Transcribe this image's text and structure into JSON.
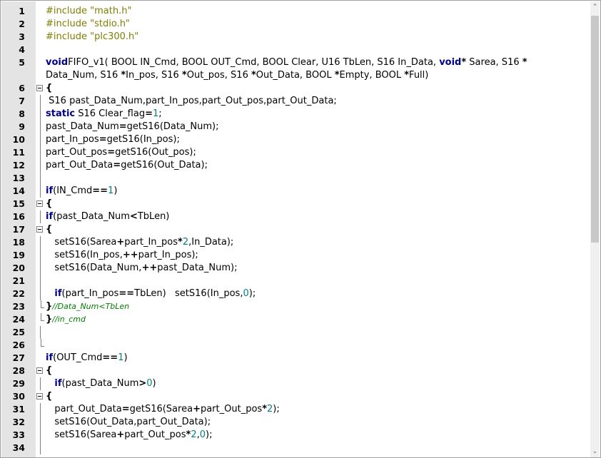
{
  "editor": {
    "lines": [
      {
        "n": "1",
        "fold": "",
        "tokens": [
          [
            "pp",
            "#include \"math.h\""
          ]
        ]
      },
      {
        "n": "2",
        "fold": "",
        "tokens": [
          [
            "pp",
            "#include \"stdio.h\""
          ]
        ]
      },
      {
        "n": "3",
        "fold": "",
        "tokens": [
          [
            "pp",
            "#include \"plc300.h\""
          ]
        ]
      },
      {
        "n": "4",
        "fold": "",
        "tokens": []
      },
      {
        "n": "5",
        "fold": "",
        "tall": true,
        "tokens": [
          [
            "kw",
            "void"
          ],
          [
            "",
            "FIFO_v1( BOOL IN_Cmd, BOOL OUT_Cmd, BOOL Clear, U16 TbLen, S16 In_Data, "
          ],
          [
            "kw",
            "void"
          ],
          [
            "op",
            "*"
          ],
          [
            "",
            " Sarea, S16 "
          ],
          [
            "op",
            "*"
          ],
          [
            "",
            "\nData_Num, S16 "
          ],
          [
            "op",
            "*"
          ],
          [
            "",
            "In_pos, S16 "
          ],
          [
            "op",
            "*"
          ],
          [
            "",
            "Out_pos, S16 "
          ],
          [
            "op",
            "*"
          ],
          [
            "",
            "Out_Data, BOOL "
          ],
          [
            "op",
            "*"
          ],
          [
            "",
            "Empty, BOOL "
          ],
          [
            "op",
            "*"
          ],
          [
            "",
            "Full)"
          ]
        ]
      },
      {
        "n": "6",
        "fold": "box",
        "tokens": [
          [
            "op",
            "{"
          ]
        ]
      },
      {
        "n": "7",
        "fold": "bar",
        "tokens": [
          [
            "",
            " S16 past_Data_Num,part_In_pos,part_Out_pos,part_Out_Data;"
          ]
        ]
      },
      {
        "n": "8",
        "fold": "bar",
        "tokens": [
          [
            "kw",
            "static"
          ],
          [
            "",
            " S16 Clear_flag"
          ],
          [
            "op",
            "="
          ],
          [
            "num",
            "1"
          ],
          [
            "",
            ";"
          ]
        ]
      },
      {
        "n": "9",
        "fold": "bar",
        "tokens": [
          [
            "",
            "past_Data_Num"
          ],
          [
            "op",
            "="
          ],
          [
            "",
            "getS16(Data_Num);"
          ]
        ]
      },
      {
        "n": "10",
        "fold": "bar",
        "tokens": [
          [
            "",
            "part_In_pos"
          ],
          [
            "op",
            "="
          ],
          [
            "",
            "getS16(In_pos);"
          ]
        ]
      },
      {
        "n": "11",
        "fold": "bar",
        "tokens": [
          [
            "",
            "part_Out_pos"
          ],
          [
            "op",
            "="
          ],
          [
            "",
            "getS16(Out_pos);"
          ]
        ]
      },
      {
        "n": "12",
        "fold": "bar",
        "tokens": [
          [
            "",
            "part_Out_Data"
          ],
          [
            "op",
            "="
          ],
          [
            "",
            "getS16(Out_Data);"
          ]
        ]
      },
      {
        "n": "13",
        "fold": "bar",
        "tokens": []
      },
      {
        "n": "14",
        "fold": "bar",
        "tokens": [
          [
            "kw",
            "if"
          ],
          [
            "",
            "(IN_Cmd"
          ],
          [
            "op",
            "=="
          ],
          [
            "num",
            "1"
          ],
          [
            "",
            ")"
          ]
        ]
      },
      {
        "n": "15",
        "fold": "box",
        "tokens": [
          [
            "op",
            "{"
          ]
        ]
      },
      {
        "n": "16",
        "fold": "bar",
        "tokens": [
          [
            "kw",
            "if"
          ],
          [
            "",
            "(past_Data_Num"
          ],
          [
            "op",
            "<"
          ],
          [
            "",
            "TbLen)"
          ]
        ]
      },
      {
        "n": "17",
        "fold": "box",
        "tokens": [
          [
            "op",
            "{"
          ]
        ]
      },
      {
        "n": "18",
        "fold": "bar",
        "tokens": [
          [
            "",
            "   setS16(Sarea"
          ],
          [
            "op",
            "+"
          ],
          [
            "",
            "part_In_pos"
          ],
          [
            "op",
            "*"
          ],
          [
            "num",
            "2"
          ],
          [
            "",
            ",In_Data);"
          ]
        ]
      },
      {
        "n": "19",
        "fold": "bar",
        "tokens": [
          [
            "",
            "   setS16(In_pos,"
          ],
          [
            "op",
            "++"
          ],
          [
            "",
            "part_In_pos);"
          ]
        ]
      },
      {
        "n": "20",
        "fold": "bar",
        "tokens": [
          [
            "",
            "   setS16(Data_Num,"
          ],
          [
            "op",
            "++"
          ],
          [
            "",
            "past_Data_Num);"
          ]
        ]
      },
      {
        "n": "21",
        "fold": "bar",
        "tokens": []
      },
      {
        "n": "22",
        "fold": "bar",
        "tokens": [
          [
            "",
            "   "
          ],
          [
            "kw",
            "if"
          ],
          [
            "",
            "(part_In_pos"
          ],
          [
            "op",
            "=="
          ],
          [
            "",
            "TbLen)   setS16(In_pos,"
          ],
          [
            "num",
            "0"
          ],
          [
            "",
            ");"
          ]
        ]
      },
      {
        "n": "23",
        "fold": "end",
        "tokens": [
          [
            "op",
            "}"
          ],
          [
            "cm",
            "//Data_Num<TbLen"
          ]
        ]
      },
      {
        "n": "24",
        "fold": "end",
        "tokens": [
          [
            "op",
            "}"
          ],
          [
            "cm",
            "//in_cmd"
          ]
        ]
      },
      {
        "n": "25",
        "fold": "bar",
        "tokens": []
      },
      {
        "n": "26",
        "fold": "end",
        "tokens": []
      },
      {
        "n": "27",
        "fold": "",
        "tokens": [
          [
            "kw",
            "if"
          ],
          [
            "",
            "(OUT_Cmd"
          ],
          [
            "op",
            "=="
          ],
          [
            "num",
            "1"
          ],
          [
            "",
            ")"
          ]
        ]
      },
      {
        "n": "28",
        "fold": "box",
        "tokens": [
          [
            "op",
            "{"
          ]
        ]
      },
      {
        "n": "29",
        "fold": "bar",
        "tokens": [
          [
            "",
            "   "
          ],
          [
            "kw",
            "if"
          ],
          [
            "",
            "(past_Data_Num"
          ],
          [
            "op",
            ">"
          ],
          [
            "num",
            "0"
          ],
          [
            "",
            ")"
          ]
        ]
      },
      {
        "n": "30",
        "fold": "box",
        "tokens": [
          [
            "op",
            "{"
          ]
        ]
      },
      {
        "n": "31",
        "fold": "bar",
        "tokens": [
          [
            "",
            "   part_Out_Data"
          ],
          [
            "op",
            "="
          ],
          [
            "",
            "getS16(Sarea"
          ],
          [
            "op",
            "+"
          ],
          [
            "",
            "part_Out_pos"
          ],
          [
            "op",
            "*"
          ],
          [
            "num",
            "2"
          ],
          [
            "",
            ");"
          ]
        ]
      },
      {
        "n": "32",
        "fold": "bar",
        "tokens": [
          [
            "",
            "   setS16(Out_Data,part_Out_Data);"
          ]
        ]
      },
      {
        "n": "33",
        "fold": "bar",
        "tokens": [
          [
            "",
            "   setS16(Sarea"
          ],
          [
            "op",
            "+"
          ],
          [
            "",
            "part_Out_pos"
          ],
          [
            "op",
            "*"
          ],
          [
            "num",
            "2"
          ],
          [
            "",
            ","
          ],
          [
            "num",
            "0"
          ],
          [
            "",
            ");"
          ]
        ]
      },
      {
        "n": "34",
        "fold": "bar",
        "tokens": []
      }
    ]
  },
  "scrollbar": {
    "up_icon": "up-arrow-icon",
    "down_icon": "down-arrow-icon",
    "up_glyph": "⌃",
    "down_glyph": "⌄"
  }
}
